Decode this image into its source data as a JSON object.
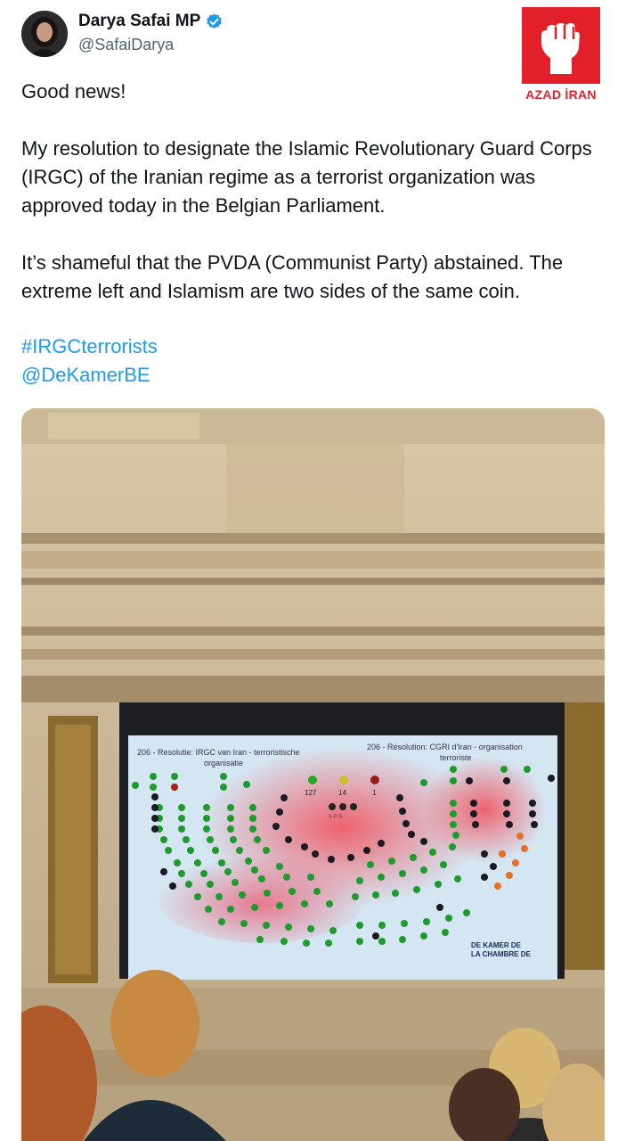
{
  "author": {
    "display_name": "Darya Safai MP",
    "handle": "@SafaiDarya",
    "avatar_icon": "person-avatar",
    "verified_icon": "verified-badge-icon"
  },
  "badge": {
    "label": "AZAD İRAN",
    "icon": "raised-fist-icon",
    "color": "#e3202a"
  },
  "tweet": {
    "line1": "Good news!",
    "para1": "My resolution to designate the Islamic Revolutionary Guard Corps (IRGC) of the Iranian regime as a terrorist organization was approved today in the Belgian Parliament.",
    "para2": "It’s shameful that the PVDA (Communist Party) abstained. The extreme left and Islamism are two sides of the same coin.",
    "hashtag": "#IRGCterrorists",
    "mention": "@DeKamerBE"
  },
  "screen": {
    "title_nl": "206 - Resolutie: IRGC van Iran - terroristische organisatie",
    "title_fr": "206 - Résolution: CGRI d'Iran - organisation terroriste",
    "count_yes": "127",
    "count_abstain": "14",
    "count_no": "1",
    "party_label": "S P S",
    "logo_line1": "DE KAMER DE",
    "logo_line2": "LA CHAMBRE DE"
  }
}
